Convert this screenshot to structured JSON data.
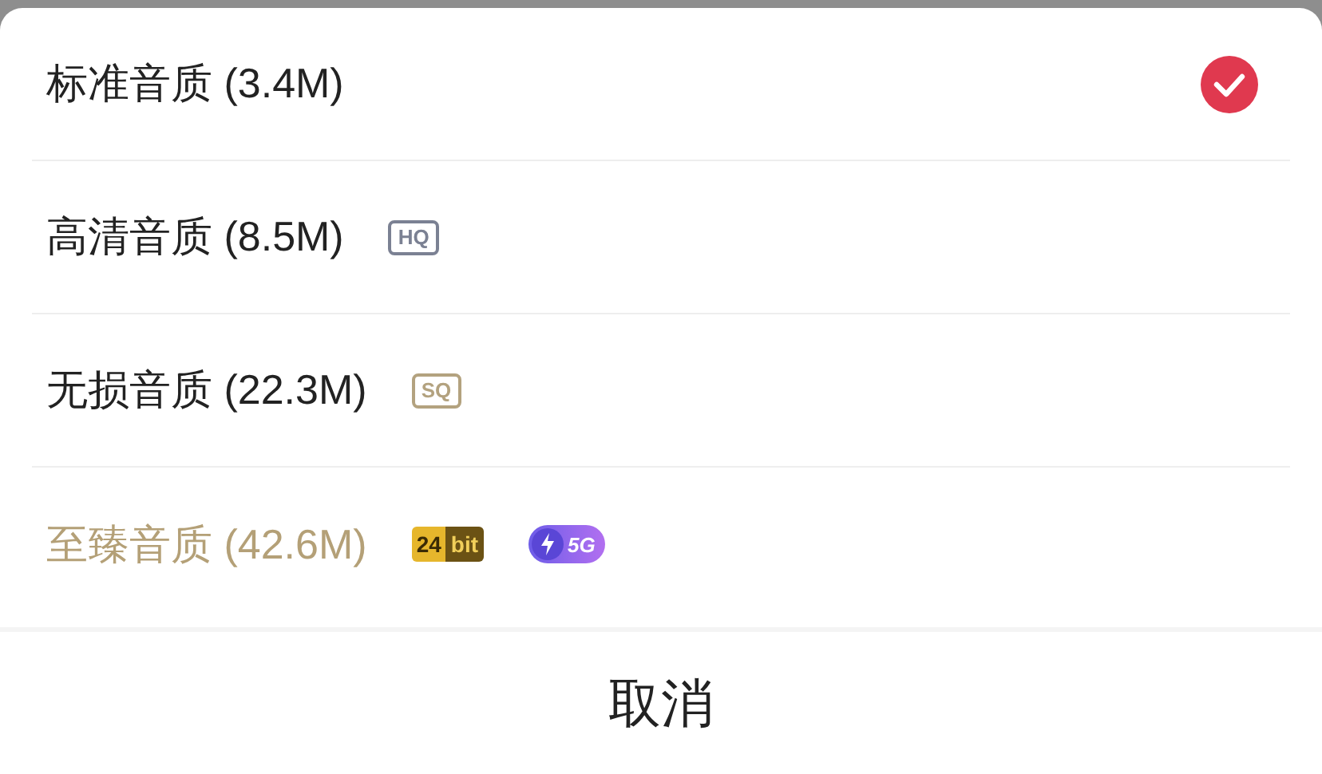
{
  "options": [
    {
      "label": "标准音质 (3.4M)",
      "kind": "standard",
      "selected": true
    },
    {
      "label": "高清音质 (8.5M)",
      "kind": "standard",
      "selected": false,
      "badges": [
        {
          "kind": "outline",
          "text": "HQ",
          "color": "#7b8193"
        }
      ]
    },
    {
      "label": "无损音质 (22.3M)",
      "kind": "standard",
      "selected": false,
      "badges": [
        {
          "kind": "outline",
          "text": "SQ",
          "color": "#b3a27f"
        }
      ]
    },
    {
      "label": "至臻音质 (42.6M)",
      "kind": "premium",
      "selected": false,
      "badges": [
        {
          "kind": "split",
          "parts": [
            "24",
            "bit"
          ]
        },
        {
          "kind": "gradient",
          "text": "5G"
        }
      ]
    }
  ],
  "cancel": "取消"
}
